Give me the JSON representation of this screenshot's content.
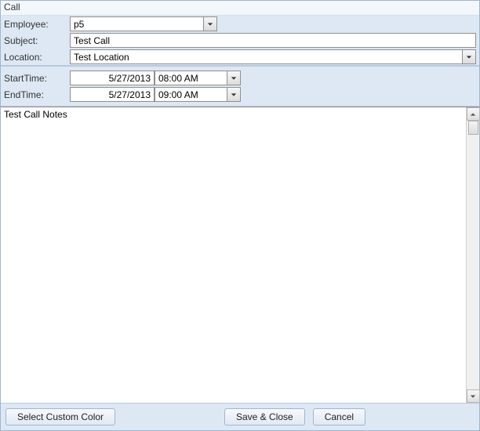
{
  "window": {
    "title": "Call"
  },
  "form": {
    "employee": {
      "label": "Employee:",
      "value": "p5"
    },
    "subject": {
      "label": "Subject:",
      "value": "Test Call"
    },
    "location": {
      "label": "Location:",
      "value": "Test Location"
    }
  },
  "times": {
    "start": {
      "label": "StartTime:",
      "date": "5/27/2013",
      "time": "08:00 AM"
    },
    "end": {
      "label": "EndTime:",
      "date": "5/27/2013",
      "time": "09:00 AM"
    }
  },
  "notes": {
    "value": "Test Call Notes"
  },
  "buttons": {
    "selectColor": "Select Custom Color",
    "saveClose": "Save & Close",
    "cancel": "Cancel"
  }
}
